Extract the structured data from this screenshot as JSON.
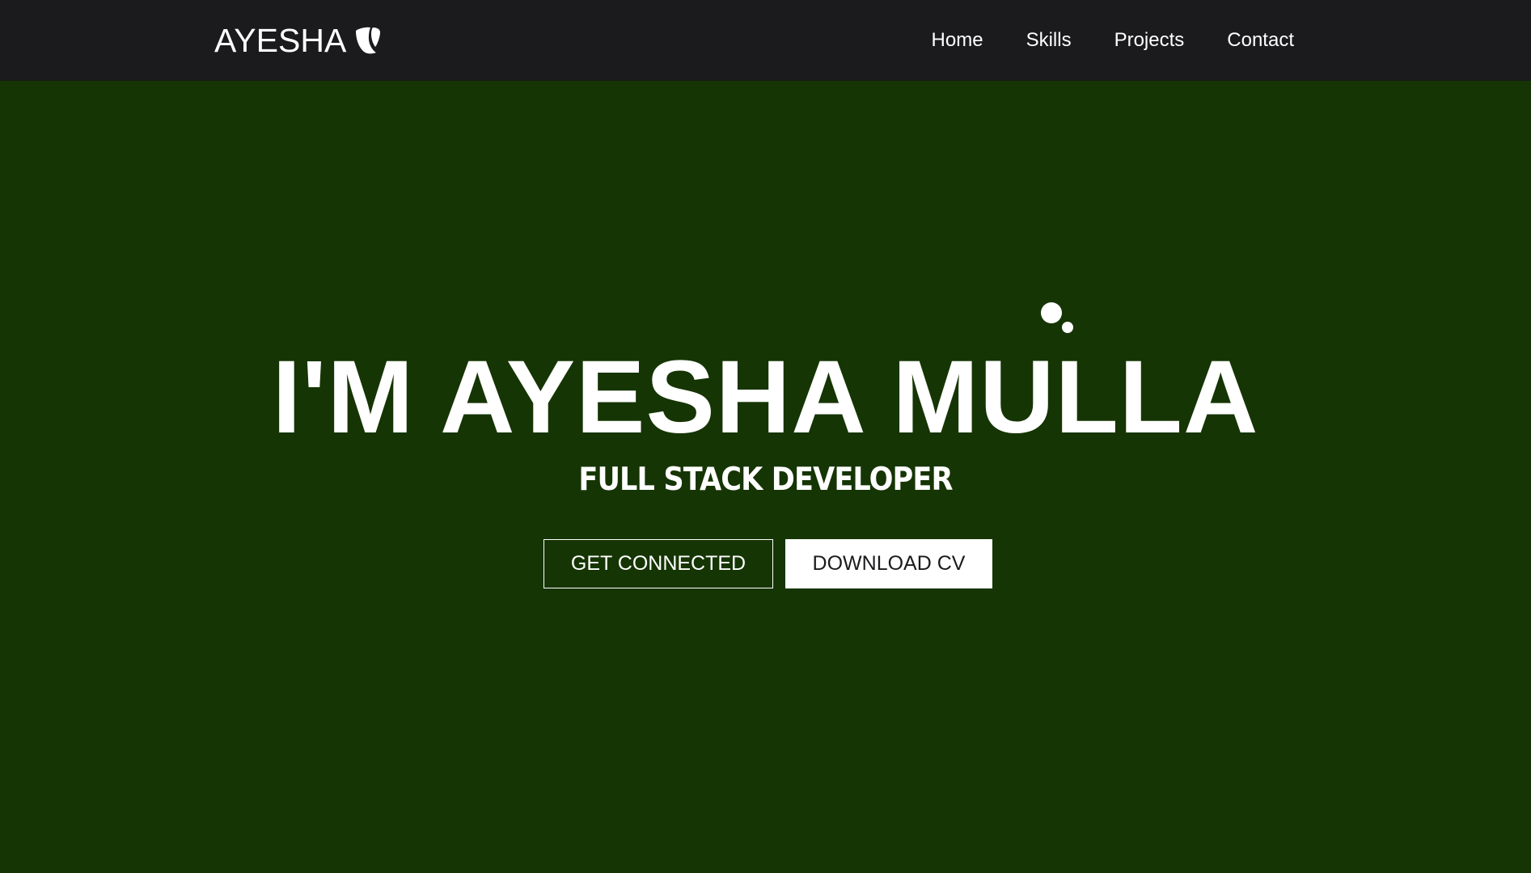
{
  "navbar": {
    "brand_name": "AYESHA",
    "brand_icon": "typo3-logo-icon",
    "links": [
      {
        "label": "Home"
      },
      {
        "label": "Skills"
      },
      {
        "label": "Projects"
      },
      {
        "label": "Contact"
      }
    ]
  },
  "hero": {
    "title": "I'M AYESHA MULLA",
    "subtitle": "FULL STACK DEVELOPER",
    "primary_button": "GET CONNECTED",
    "secondary_button": "DOWNLOAD CV"
  },
  "colors": {
    "navbar_bg": "#1b1a1c",
    "hero_bg": "#163504",
    "text": "#ffffff"
  }
}
